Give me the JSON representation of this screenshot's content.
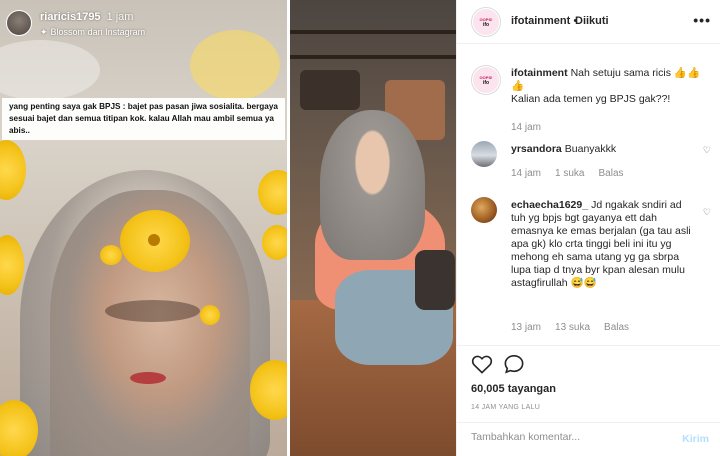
{
  "story": {
    "username": "riaricis1795",
    "time": "1 jam",
    "sub_effect": "Blossom",
    "sub_from": "dari Instagram",
    "caption": "yang penting saya gak BPJS : bajet pas pasan jiwa sosialita. bergaya sesuai bajet dan semua titipan kok. kalau Allah mau ambil semua ya abis.."
  },
  "header": {
    "username": "ifotainment",
    "separator": " • ",
    "follow_status": "Diikuti",
    "more_icon": "more-dots-icon",
    "logo_line1": "OOPS!",
    "logo_line2": "ifo"
  },
  "comments": [
    {
      "username": "ifotainment",
      "text": "Nah setuju sama ricis 👍👍👍\nKalian ada temen yg BPJS gak??!",
      "time": "14 jam"
    },
    {
      "username": "yrsandora",
      "text": "Buanyakkk",
      "time": "14 jam",
      "likes": "1 suka",
      "reply": "Balas"
    },
    {
      "username": "echaecha1629_",
      "text": "Jd ngakak sndiri ad tuh yg bpjs bgt gayanya ett dah emasnya ke emas berjalan (ga tau asli apa gk) klo crta tinggi beli ini itu yg mehong eh sama utang yg ga sbrpa lupa tiap d tnya byr kpan alesan mulu astagfirullah 😅😅",
      "time": "13 jam",
      "likes": "13 suka",
      "reply": "Balas"
    }
  ],
  "actions": {
    "views": "60,005 tayangan",
    "posted": "14 JAM YANG LALU"
  },
  "comment_box": {
    "placeholder": "Tambahkan komentar...",
    "post_label": "Kirim"
  },
  "colors": {
    "post_button": "#b2dffc",
    "meta_gray": "#8e8e8e"
  }
}
